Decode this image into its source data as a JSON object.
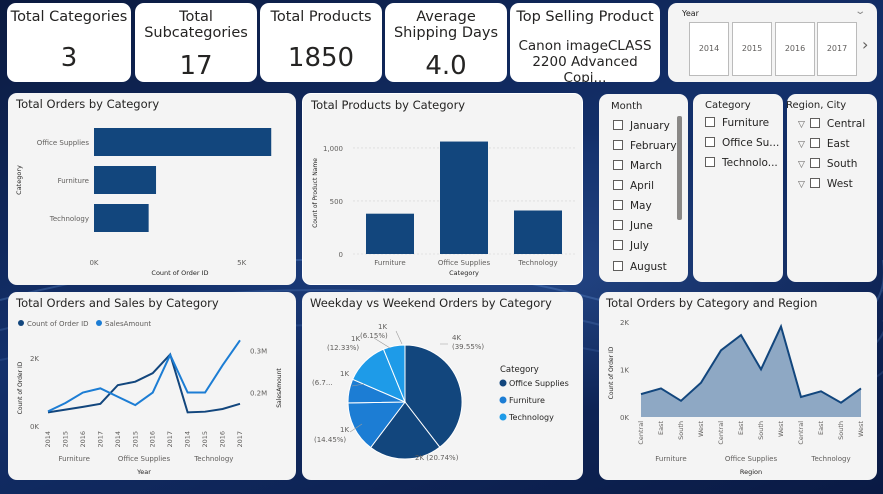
{
  "kpis": [
    {
      "title": "Total Categories",
      "value": "3"
    },
    {
      "title": "Total Subcategories",
      "value": "17"
    },
    {
      "title": "Total Products",
      "value": "1850"
    },
    {
      "title": "Average Shipping Days",
      "value": "4.0"
    },
    {
      "title": "Top Selling Product",
      "value": "Canon imageCLASS 2200 Advanced Copi..."
    }
  ],
  "year_slicer": {
    "label": "Year",
    "years": [
      "2014",
      "2015",
      "2016",
      "2017"
    ],
    "chevron": "chevron-down-icon",
    "next": "chevron-right-icon"
  },
  "month_slicer": {
    "title": "Month",
    "items": [
      "January",
      "February",
      "March",
      "April",
      "May",
      "June",
      "July",
      "August"
    ]
  },
  "category_slicer": {
    "title": "Category",
    "items": [
      "Furniture",
      "Office Su...",
      "Technolo..."
    ]
  },
  "region_slicer": {
    "title": "Region, City",
    "items": [
      "Central",
      "East",
      "South",
      "West"
    ]
  },
  "colors": {
    "primary": "#12467d",
    "secondary": "#1c7dd4",
    "tertiary": "#1e9be8",
    "area_fill": "#8ea8c4"
  },
  "chart_data": [
    {
      "id": "orders-by-category",
      "type": "bar",
      "orientation": "horizontal",
      "title": "Total Orders by Category",
      "xlabel": "Count of Order ID",
      "ylabel": "Category",
      "categories": [
        "Office Supplies",
        "Furniture",
        "Technology"
      ],
      "values": [
        6000,
        2100,
        1850
      ],
      "xlim": [
        0,
        6500
      ],
      "xticks": [
        {
          "v": 0,
          "label": "0K"
        },
        {
          "v": 5000,
          "label": "5K"
        }
      ],
      "grid": false
    },
    {
      "id": "products-by-category",
      "type": "bar",
      "title": "Total Products by Category",
      "xlabel": "Category",
      "ylabel": "Count of Product Name",
      "categories": [
        "Furniture",
        "Office Supplies",
        "Technology"
      ],
      "values": [
        380,
        1060,
        410
      ],
      "ylim": [
        0,
        1150
      ],
      "yticks": [
        {
          "v": 0,
          "label": "0"
        },
        {
          "v": 500,
          "label": "500"
        },
        {
          "v": 1000,
          "label": "1,000"
        }
      ],
      "grid": true
    },
    {
      "id": "orders-sales-by-category",
      "type": "line",
      "title": "Total Orders and Sales by Category",
      "xlabel": "Year",
      "ylabel": "Count of Order ID",
      "y2label": "SalesAmount",
      "x": [
        "2014",
        "2015",
        "2016",
        "2017",
        "2014",
        "2015",
        "2016",
        "2017",
        "2014",
        "2015",
        "2016",
        "2017"
      ],
      "groups": [
        "Furniture",
        "Office Supplies",
        "Technology"
      ],
      "series": [
        {
          "name": "Count of Order ID",
          "axis": "left",
          "values": [
            400,
            480,
            560,
            650,
            1200,
            1300,
            1550,
            2100,
            400,
            420,
            500,
            650
          ]
        },
        {
          "name": "SalesAmount",
          "axis": "right",
          "values": [
            0.155,
            0.175,
            0.2,
            0.21,
            0.19,
            0.17,
            0.2,
            0.29,
            0.2,
            0.2,
            0.265,
            0.325
          ]
        }
      ],
      "ylim": [
        0,
        2700
      ],
      "y2lim": [
        0.12,
        0.34
      ],
      "yticks": [
        {
          "v": 0,
          "label": "0K"
        },
        {
          "v": 2000,
          "label": "2K"
        }
      ],
      "y2ticks": [
        {
          "v": 0.2,
          "label": "0.2M"
        },
        {
          "v": 0.3,
          "label": "0.3M"
        }
      ],
      "legend": "top-left"
    },
    {
      "id": "weekday-weekend-orders",
      "type": "pie",
      "title": "Weekday vs Weekend Orders by Category",
      "legend_title": "Category",
      "legend_items": [
        "Office Supplies",
        "Furniture",
        "Technology"
      ],
      "slices": [
        {
          "category": "Office Supplies",
          "label": "4K",
          "percent": 39.55
        },
        {
          "category": "Office Supplies",
          "label": "2K (20.74%)",
          "percent": 20.74
        },
        {
          "category": "Furniture",
          "label": "1K (14.45%)",
          "percent": 14.45
        },
        {
          "category": "Furniture",
          "label": "1K (6.7...)",
          "percent": 6.77
        },
        {
          "category": "Technology",
          "label": "1K (12.33%)",
          "percent": 12.33
        },
        {
          "category": "Technology",
          "label": "1K (6.15%)",
          "percent": 6.15
        }
      ],
      "labels": {
        "top_value": "4K",
        "top_pct": "(39.55%)",
        "s2": "2K (20.74%)",
        "s3a": "1K",
        "s3b": "(14.45%)",
        "s4a": "1K",
        "s4b": "(6.7...",
        "s5a": "1K",
        "s5b": "(12.33%)",
        "s6a": "1K",
        "s6b": "(6.15%)"
      },
      "legend": "right"
    },
    {
      "id": "orders-by-category-region",
      "type": "area",
      "title": "Total Orders by Category and Region",
      "xlabel": "Region",
      "ylabel": "Count of Order ID",
      "x": [
        "Central",
        "East",
        "South",
        "West",
        "Central",
        "East",
        "South",
        "West",
        "Central",
        "East",
        "South",
        "West"
      ],
      "groups": [
        "Furniture",
        "Office Supplies",
        "Technology"
      ],
      "values": [
        480,
        600,
        340,
        720,
        1400,
        1720,
        1000,
        1900,
        420,
        540,
        300,
        600
      ],
      "ylim": [
        0,
        2100
      ],
      "yticks": [
        {
          "v": 0,
          "label": "0K"
        },
        {
          "v": 1000,
          "label": "1K"
        },
        {
          "v": 2000,
          "label": "2K"
        }
      ]
    }
  ]
}
